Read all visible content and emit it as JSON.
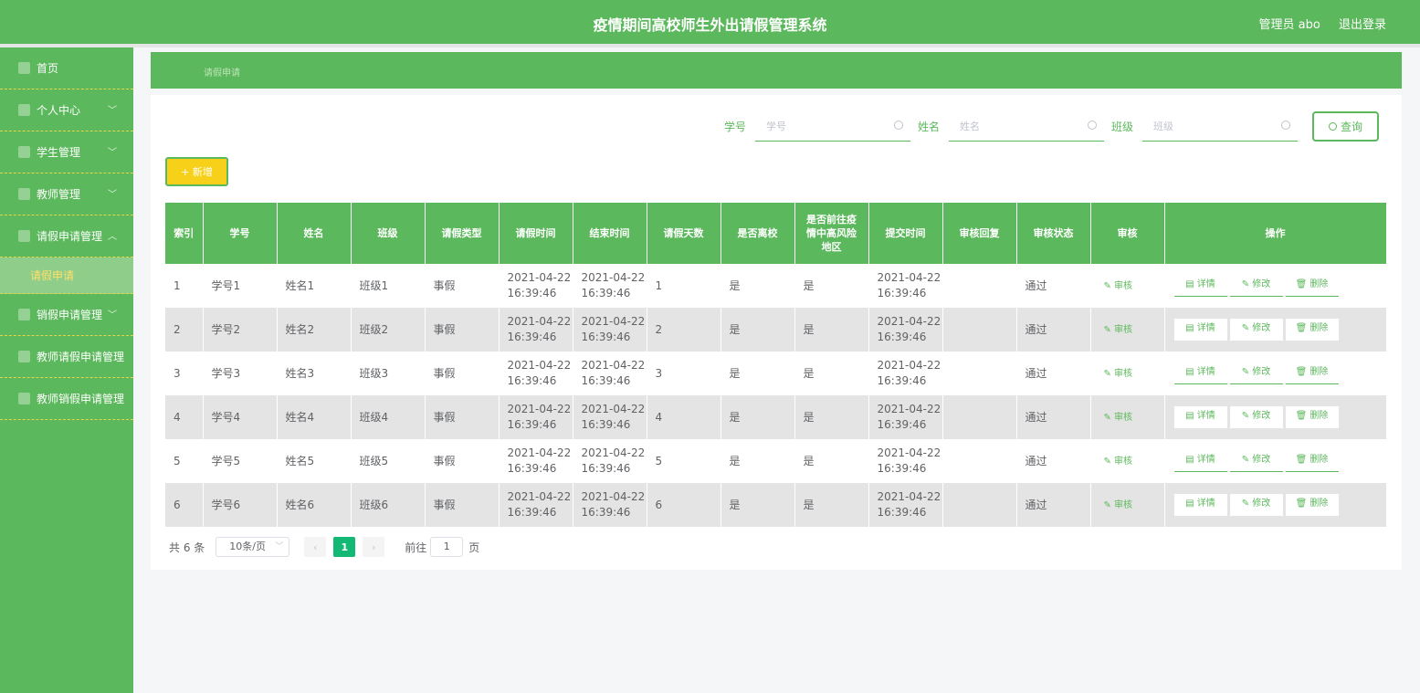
{
  "header": {
    "title": "疫情期间高校师生外出请假管理系统",
    "user": "管理员 abo",
    "logout": "退出登录"
  },
  "sidebar": {
    "items": [
      {
        "label": "首页",
        "icon": "home-icon",
        "chevron": ""
      },
      {
        "label": "个人中心",
        "icon": "user-icon",
        "chevron": "﹀"
      },
      {
        "label": "学生管理",
        "icon": "student-icon",
        "chevron": "﹀"
      },
      {
        "label": "教师管理",
        "icon": "teacher-icon",
        "chevron": "﹀"
      },
      {
        "label": "请假申请管理",
        "icon": "leave-icon",
        "chevron": "︿"
      },
      {
        "label": "销假申请管理",
        "icon": "return-icon",
        "chevron": "﹀"
      },
      {
        "label": "教师请假申请管理",
        "icon": "doc-icon",
        "chevron": ""
      },
      {
        "label": "教师销假申请管理",
        "icon": "doc-icon",
        "chevron": ""
      }
    ],
    "sub_item": "请假申请"
  },
  "breadcrumb": "请假申请",
  "search": {
    "fields": [
      {
        "label": "学号",
        "placeholder": "学号"
      },
      {
        "label": "姓名",
        "placeholder": "姓名"
      },
      {
        "label": "班级",
        "placeholder": "班级"
      }
    ],
    "button": "查询"
  },
  "add_button": "+ 新增",
  "table": {
    "headers": [
      "索引",
      "学号",
      "姓名",
      "班级",
      "请假类型",
      "请假时间",
      "结束时间",
      "请假天数",
      "是否离校",
      "是否前往疫情中高风险地区",
      "提交时间",
      "审核回复",
      "审核状态",
      "审核",
      "操作"
    ],
    "audit_label": "✎ 审核",
    "detail_label": "▤ 详情",
    "edit_label": "✎ 修改",
    "delete_label": "🗑 删除",
    "rows": [
      {
        "idx": "1",
        "no": "学号1",
        "name": "姓名1",
        "cls": "班级1",
        "type": "事假",
        "start_d": "2021-04-22",
        "start_t": "16:39:46",
        "end_d": "2021-04-22",
        "end_t": "16:39:46",
        "days": "1",
        "leave_school": "是",
        "risk_area": "是",
        "sub_d": "2021-04-22",
        "sub_t": "16:39:46",
        "reply": "",
        "status": "通过"
      },
      {
        "idx": "2",
        "no": "学号2",
        "name": "姓名2",
        "cls": "班级2",
        "type": "事假",
        "start_d": "2021-04-22",
        "start_t": "16:39:46",
        "end_d": "2021-04-22",
        "end_t": "16:39:46",
        "days": "2",
        "leave_school": "是",
        "risk_area": "是",
        "sub_d": "2021-04-22",
        "sub_t": "16:39:46",
        "reply": "",
        "status": "通过"
      },
      {
        "idx": "3",
        "no": "学号3",
        "name": "姓名3",
        "cls": "班级3",
        "type": "事假",
        "start_d": "2021-04-22",
        "start_t": "16:39:46",
        "end_d": "2021-04-22",
        "end_t": "16:39:46",
        "days": "3",
        "leave_school": "是",
        "risk_area": "是",
        "sub_d": "2021-04-22",
        "sub_t": "16:39:46",
        "reply": "",
        "status": "通过"
      },
      {
        "idx": "4",
        "no": "学号4",
        "name": "姓名4",
        "cls": "班级4",
        "type": "事假",
        "start_d": "2021-04-22",
        "start_t": "16:39:46",
        "end_d": "2021-04-22",
        "end_t": "16:39:46",
        "days": "4",
        "leave_school": "是",
        "risk_area": "是",
        "sub_d": "2021-04-22",
        "sub_t": "16:39:46",
        "reply": "",
        "status": "通过"
      },
      {
        "idx": "5",
        "no": "学号5",
        "name": "姓名5",
        "cls": "班级5",
        "type": "事假",
        "start_d": "2021-04-22",
        "start_t": "16:39:46",
        "end_d": "2021-04-22",
        "end_t": "16:39:46",
        "days": "5",
        "leave_school": "是",
        "risk_area": "是",
        "sub_d": "2021-04-22",
        "sub_t": "16:39:46",
        "reply": "",
        "status": "通过"
      },
      {
        "idx": "6",
        "no": "学号6",
        "name": "姓名6",
        "cls": "班级6",
        "type": "事假",
        "start_d": "2021-04-22",
        "start_t": "16:39:46",
        "end_d": "2021-04-22",
        "end_t": "16:39:46",
        "days": "6",
        "leave_school": "是",
        "risk_area": "是",
        "sub_d": "2021-04-22",
        "sub_t": "16:39:46",
        "reply": "",
        "status": "通过"
      }
    ]
  },
  "pagination": {
    "total": "共 6 条",
    "page_size": "10条/页",
    "prev": "‹",
    "current": "1",
    "next": "›",
    "goto_label": "前往",
    "goto_value": "1",
    "page_suffix": "页"
  },
  "colors": {
    "primary": "#5cb85c",
    "add_button": "#f7d119",
    "active_sub": "#ffe16b",
    "pager_current": "#13b875"
  }
}
